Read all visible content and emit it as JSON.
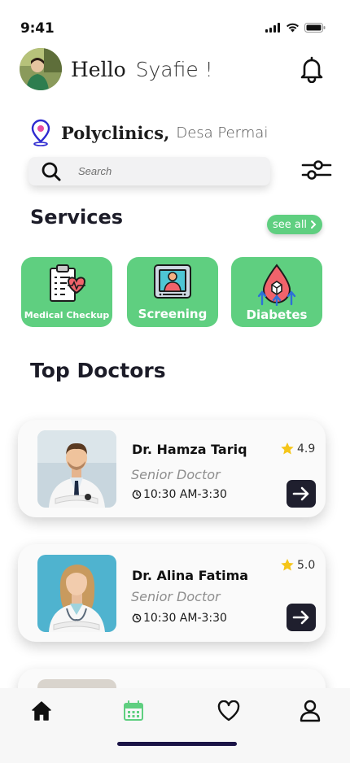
{
  "status_bar": {
    "time": "9:41"
  },
  "header": {
    "greeting": "Hello",
    "user_name": "Syafie !"
  },
  "location": {
    "title": "Polyclinics,",
    "subtitle": "Desa Permai"
  },
  "search": {
    "placeholder": "Search"
  },
  "services": {
    "title": "Services",
    "see_all_label": "see all",
    "items": [
      {
        "label": "Medical Checkup",
        "icon": "clipboard-heartbeat-icon"
      },
      {
        "label": "Screening",
        "icon": "monitor-doctor-icon"
      },
      {
        "label": "Diabetes",
        "icon": "blood-drop-icon"
      }
    ]
  },
  "top_doctors": {
    "title": "Top Doctors",
    "items": [
      {
        "name": "Dr. Hamza Tariq",
        "role": "Senior Doctor",
        "hours": "10:30 AM-3:30",
        "rating": "4.9"
      },
      {
        "name": "Dr. Alina Fatima",
        "role": "Senior Doctor",
        "hours": "10:30 AM-3:30",
        "rating": "5.0"
      }
    ]
  },
  "tab_bar": {
    "items": [
      {
        "icon": "home-icon",
        "active": false
      },
      {
        "icon": "calendar-icon",
        "active": true
      },
      {
        "icon": "heart-icon",
        "active": false
      },
      {
        "icon": "user-icon",
        "active": false
      }
    ]
  },
  "colors": {
    "accent_green": "#5fcf80",
    "dark": "#1f1f2e",
    "star": "#f5c518",
    "home_indicator": "#1b1446"
  }
}
